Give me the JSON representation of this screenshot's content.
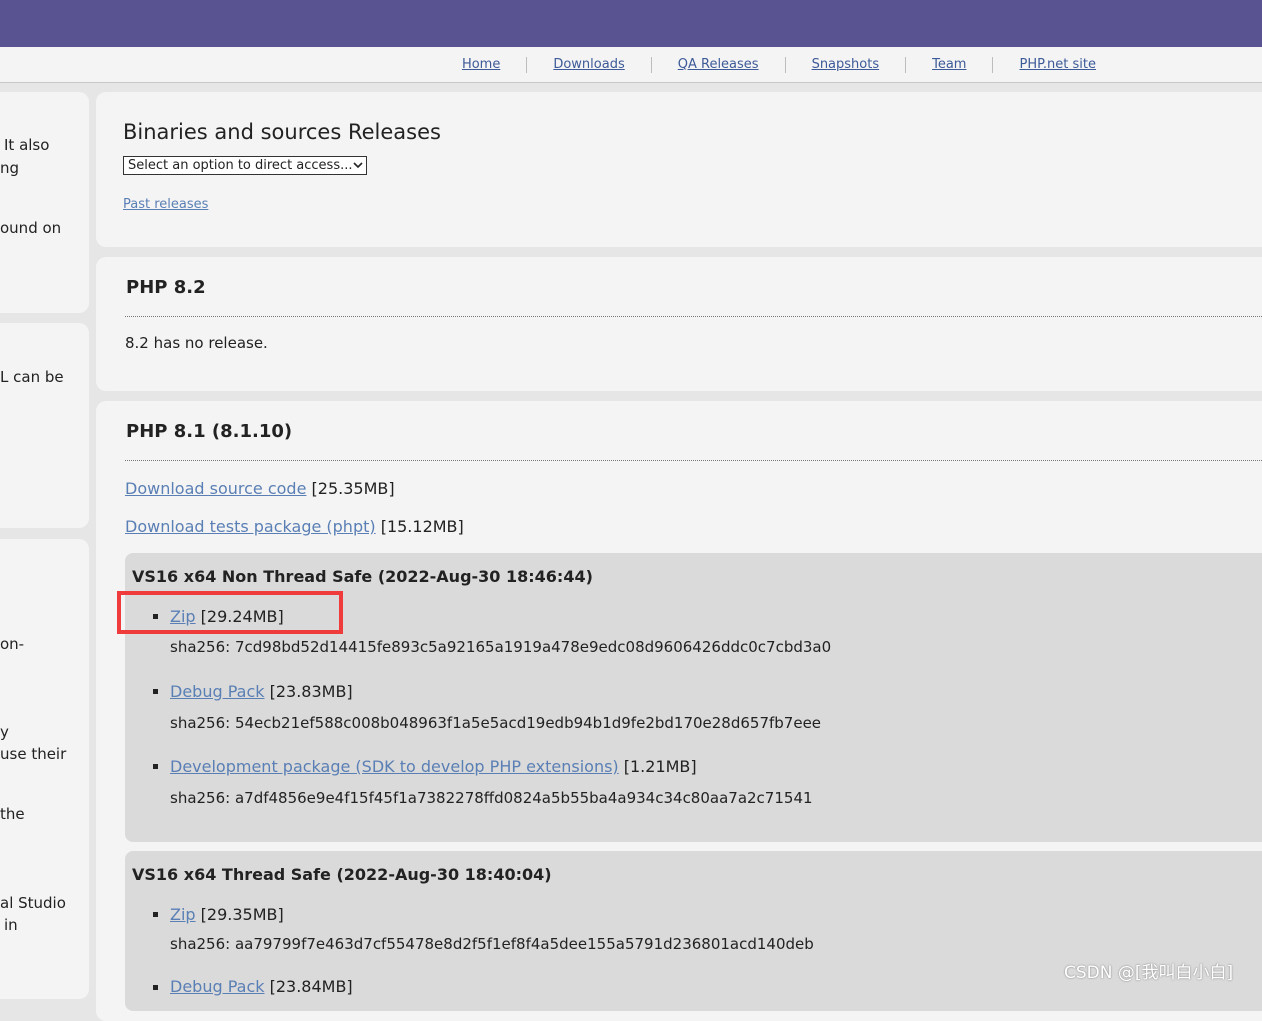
{
  "nav": {
    "items": [
      {
        "label": "Home"
      },
      {
        "label": "Downloads"
      },
      {
        "label": "QA Releases"
      },
      {
        "label": "Snapshots"
      },
      {
        "label": "Team"
      },
      {
        "label": "PHP.net site"
      }
    ]
  },
  "sidebar": {
    "fragments": [
      "It also",
      "ng",
      "ound on",
      "L can be",
      "on-",
      "y",
      "use their",
      "the",
      "al Studio",
      "in"
    ]
  },
  "releases_panel": {
    "title": "Binaries and sources Releases",
    "select_value": "Select an option to direct access...",
    "past_releases_label": "Past releases"
  },
  "php82": {
    "title": "PHP 8.2",
    "message": "8.2 has no release."
  },
  "php81": {
    "title": "PHP 8.1 (8.1.10)",
    "source": {
      "label": "Download source code",
      "size": "[25.35MB]"
    },
    "tests": {
      "label": "Download tests package (phpt)",
      "size": "[15.12MB]"
    },
    "builds": [
      {
        "title": "VS16 x64 Non Thread Safe (2022-Aug-30 18:46:44)",
        "files": [
          {
            "label": "Zip",
            "size": "[29.24MB]",
            "sha": "sha256: 7cd98bd52d14415fe893c5a92165a1919a478e9edc08d9606426ddc0c7cbd3a0"
          },
          {
            "label": "Debug Pack",
            "size": "[23.83MB]",
            "sha": "sha256: 54ecb21ef588c008b048963f1a5e5acd19edb94b1d9fe2bd170e28d657fb7eee"
          },
          {
            "label": "Development package (SDK to develop PHP extensions)",
            "size": "[1.21MB]",
            "sha": "sha256: a7df4856e9e4f15f45f1a7382278ffd0824a5b55ba4a934c34c80aa7a2c71541"
          }
        ]
      },
      {
        "title": "VS16 x64 Thread Safe (2022-Aug-30 18:40:04)",
        "files": [
          {
            "label": "Zip",
            "size": "[29.35MB]",
            "sha": "sha256: aa79799f7e463d7cf55478e8d2f5f1ef8f4a5dee155a5791d236801acd140deb"
          },
          {
            "label": "Debug Pack",
            "size": "[23.84MB]"
          }
        ]
      }
    ]
  },
  "watermark": "CSDN @[我叫白小白]",
  "colors": {
    "header": "#5a5391",
    "link": "#5a7fb5",
    "highlight": "#ef3b3b"
  }
}
